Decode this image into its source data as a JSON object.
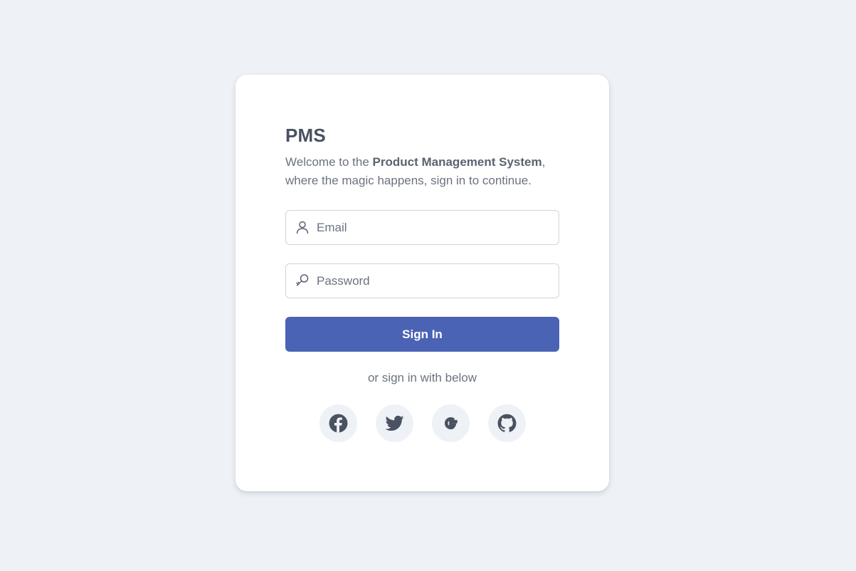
{
  "login": {
    "title": "PMS",
    "welcome_prefix": "Welcome to the ",
    "welcome_bold": "Product Management System",
    "welcome_suffix": ", where the magic happens, sign in to continue.",
    "email": {
      "placeholder": "Email",
      "value": "",
      "icon": "user-icon"
    },
    "password": {
      "placeholder": "Password",
      "value": "",
      "icon": "key-icon"
    },
    "signin_label": "Sign In",
    "or_text": "or sign in with below",
    "socials": [
      {
        "name": "facebook",
        "icon": "facebook-icon"
      },
      {
        "name": "twitter",
        "icon": "twitter-icon"
      },
      {
        "name": "google",
        "icon": "google-icon"
      },
      {
        "name": "github",
        "icon": "github-icon"
      }
    ]
  },
  "colors": {
    "page_background": "#eef1f6",
    "card_background": "#ffffff",
    "primary_button": "#4b63b5",
    "icon_color": "#4a5160",
    "text_muted": "#6b7280"
  }
}
